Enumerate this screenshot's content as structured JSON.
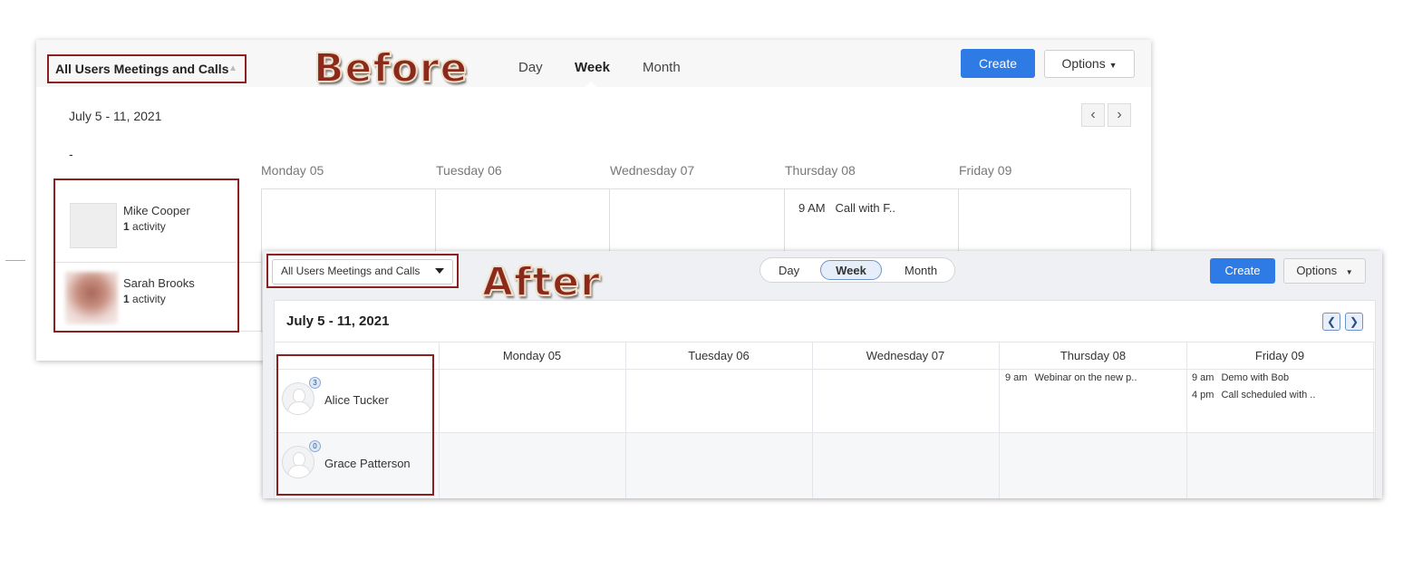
{
  "before": {
    "stamp": "Before",
    "filter": "All Users Meetings and Calls",
    "views": [
      "Day",
      "Week",
      "Month"
    ],
    "create": "Create",
    "options": "Options",
    "date_range": "July 5 - 11, 2021",
    "corner": "-",
    "days": [
      "Monday 05",
      "Tuesday 06",
      "Wednesday 07",
      "Thursday 08",
      "Friday 09"
    ],
    "users": [
      {
        "name": "Mike Cooper",
        "count": "1",
        "unit": "activity"
      },
      {
        "name": "Sarah Brooks",
        "count": "1",
        "unit": "activity"
      }
    ],
    "event": {
      "time": "9 AM",
      "title": "Call with F.."
    }
  },
  "after": {
    "stamp": "After",
    "filter": "All Users Meetings and Calls",
    "views": [
      "Day",
      "Week",
      "Month"
    ],
    "create": "Create",
    "options": "Options",
    "date_range": "July 5 - 11, 2021",
    "days": [
      "Monday 05",
      "Tuesday 06",
      "Wednesday 07",
      "Thursday 08",
      "Friday 09"
    ],
    "users": [
      {
        "name": "Alice Tucker",
        "badge": "3"
      },
      {
        "name": "Grace Patterson",
        "badge": "0"
      }
    ],
    "events": [
      {
        "time": "9 am",
        "title": "Webinar on the new p.."
      },
      {
        "time": "9 am",
        "title": "Demo with Bob"
      },
      {
        "time": "4 pm",
        "title": "Call scheduled with .."
      }
    ]
  },
  "colors": {
    "accent": "#2f7be6",
    "highlight_box": "#8b2020"
  }
}
